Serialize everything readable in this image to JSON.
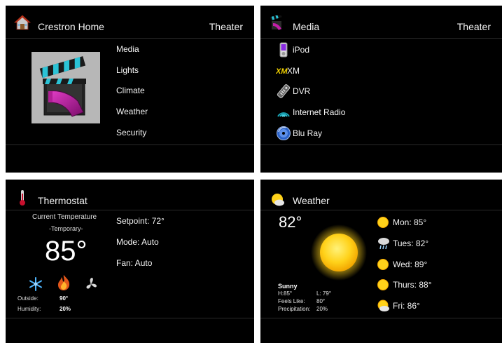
{
  "home": {
    "title": "Crestron Home",
    "room": "Theater",
    "menu": [
      "Media",
      "Lights",
      "Climate",
      "Weather",
      "Security"
    ]
  },
  "media": {
    "title": "Media",
    "room": "Theater",
    "sources": [
      {
        "label": "iPod",
        "icon": "ipod-icon"
      },
      {
        "label": "XM",
        "icon": "xm-icon"
      },
      {
        "label": "DVR",
        "icon": "remote-icon"
      },
      {
        "label": "Internet Radio",
        "icon": "radio-waves-icon"
      },
      {
        "label": "Blu Ray",
        "icon": "bluray-disc-icon"
      }
    ]
  },
  "thermostat": {
    "title": "Thermostat",
    "current_label": "Current Temperature",
    "mode_note": "-Temporary-",
    "temperature": "85°",
    "setpoint": "Setpoint: 72°",
    "mode": "Mode: Auto",
    "fan": "Fan: Auto",
    "outside_label": "Outside:",
    "outside_value": "90°",
    "humidity_label": "Humidity:",
    "humidity_value": "20%"
  },
  "weather": {
    "title": "Weather",
    "temperature": "82°",
    "condition": "Sunny",
    "high": "H:85°",
    "low": "L: 79°",
    "feels_label": "Feels Like:",
    "feels_value": "80°",
    "precip_label": "Precipitation:",
    "precip_value": "20%",
    "forecast": [
      {
        "label": "Mon: 85°",
        "icon": "sun-icon"
      },
      {
        "label": "Tues: 82°",
        "icon": "rain-cloud-icon"
      },
      {
        "label": "Wed: 89°",
        "icon": "sun-icon"
      },
      {
        "label": "Thurs: 88°",
        "icon": "sun-icon"
      },
      {
        "label": "Fri: 86°",
        "icon": "partly-cloudy-icon"
      }
    ]
  },
  "colors": {
    "panel_bg": "#000000",
    "accent_magenta": "#c21fa8",
    "accent_cyan": "#2ac3d6",
    "sun_yellow": "#ffd21a",
    "xm_yellow": "#f5d400"
  }
}
